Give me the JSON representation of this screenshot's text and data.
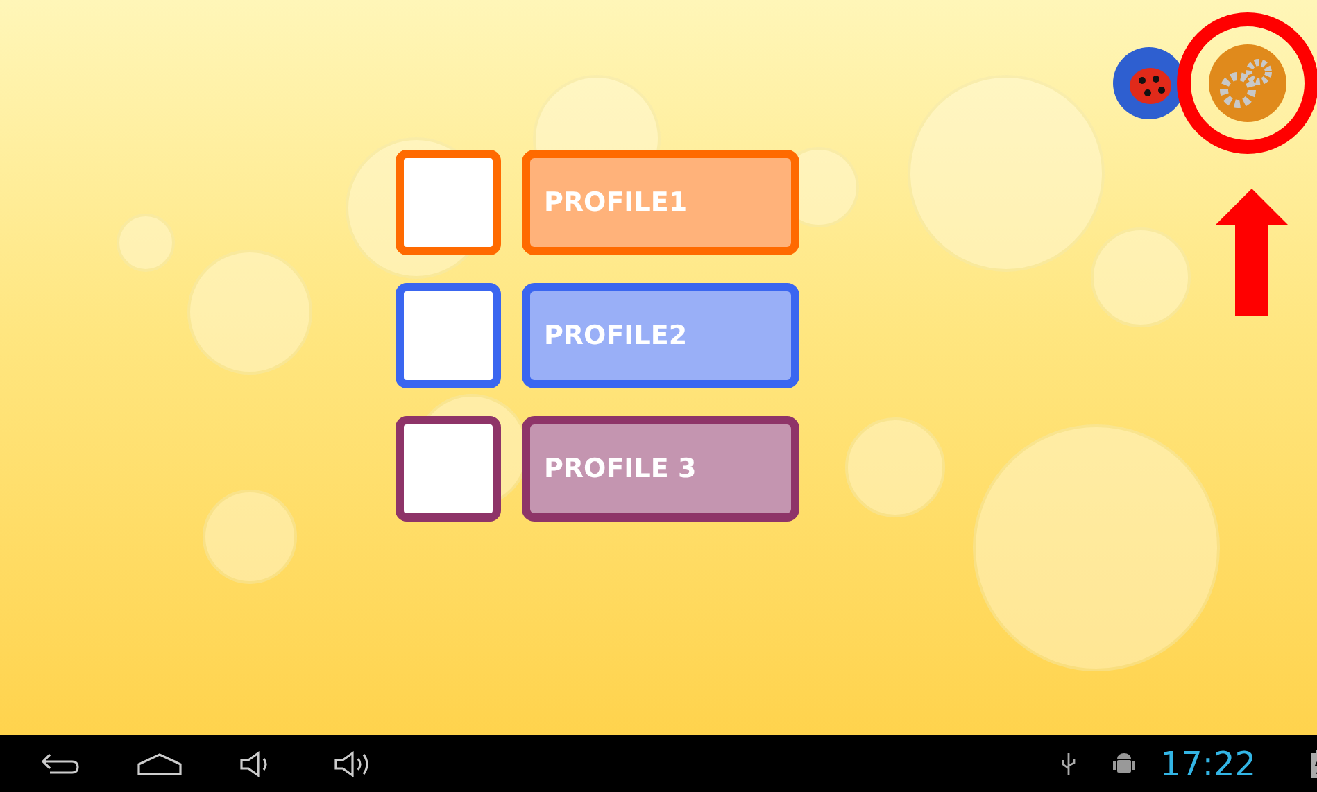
{
  "profiles": [
    {
      "label": "PROFILE1",
      "color": "#ff6a00"
    },
    {
      "label": "PROFILE2",
      "color": "#3a66f0"
    },
    {
      "label": "PROFILE 3",
      "color": "#8e3468"
    }
  ],
  "status_bar": {
    "time": "17:22"
  }
}
